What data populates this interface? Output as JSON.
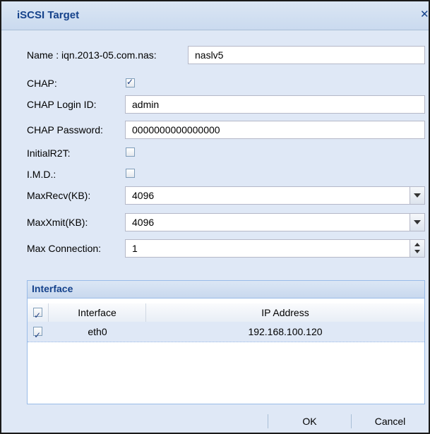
{
  "dialog": {
    "title": "iSCSI Target",
    "close_glyph": "✕"
  },
  "form": {
    "name_label": "Name : iqn.2013-05.com.nas:",
    "name_value": "naslv5",
    "chap_label": "CHAP:",
    "chap_checked": true,
    "chap_login_label": "CHAP Login ID:",
    "chap_login_value": "admin",
    "chap_password_label": "CHAP Password:",
    "chap_password_value": "0000000000000000",
    "initial_r2t_label": "InitialR2T:",
    "initial_r2t_checked": false,
    "imd_label": "I.M.D.:",
    "imd_checked": false,
    "max_recv_label": "MaxRecv(KB):",
    "max_recv_value": "4096",
    "max_xmit_label": "MaxXmit(KB):",
    "max_xmit_value": "4096",
    "max_connection_label": "Max Connection:",
    "max_connection_value": "1"
  },
  "interface_panel": {
    "title": "Interface",
    "columns": [
      "Interface",
      "IP Address"
    ],
    "header_checked": true,
    "rows": [
      {
        "checked": true,
        "interface": "eth0",
        "ip": "192.168.100.120"
      }
    ]
  },
  "footer": {
    "ok_label": "OK",
    "cancel_label": "Cancel"
  },
  "icons": {
    "close": "close-icon",
    "checkbox": "checkbox-icon",
    "dropdown": "chevron-down-icon",
    "spinner": "spinner-arrows-icon"
  },
  "colors": {
    "title_text": "#15428b",
    "dialog_bg": "#dfe8f6",
    "border": "#99bbe8"
  }
}
